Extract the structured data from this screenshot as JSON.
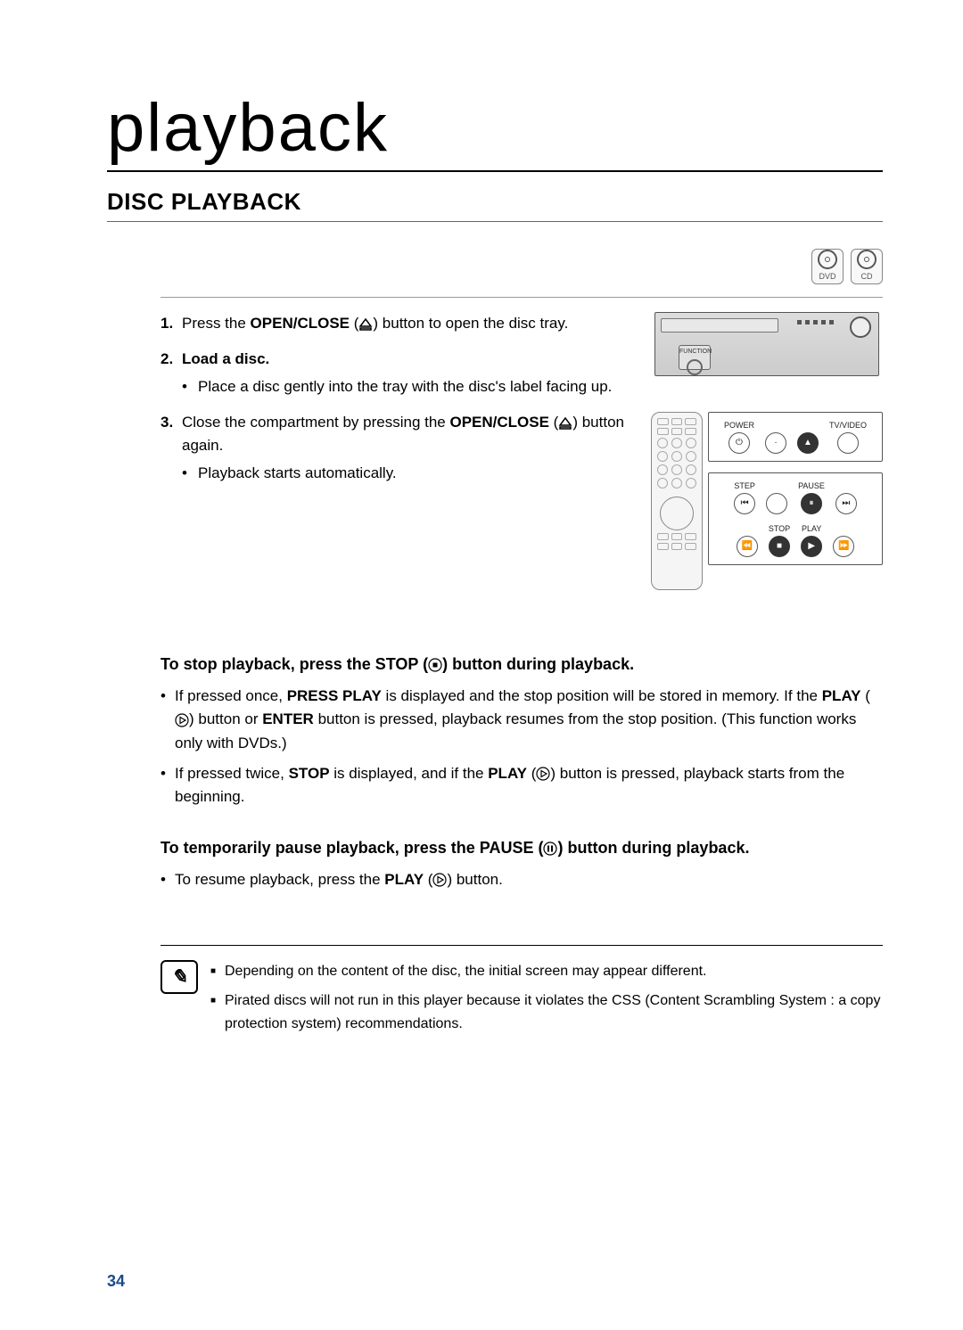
{
  "title": "playback",
  "section_heading": "DISC PLAYBACK",
  "badges": {
    "dvd": "DVD",
    "cd": "CD"
  },
  "steps": [
    {
      "num": "1.",
      "text_pre": "Press the ",
      "bold": "OPEN/CLOSE",
      "text_mid": " (",
      "text_post": ") button to open the disc tray."
    },
    {
      "num": "2.",
      "bold": "Load a disc.",
      "sub": "Place a disc gently into the tray with the disc's label facing up."
    },
    {
      "num": "3.",
      "text_pre": "Close the compartment by pressing the ",
      "bold": "OPEN/CLOSE",
      "text_mid": " (",
      "text_post": ") button again.",
      "sub": "Playback starts automatically."
    }
  ],
  "player": {
    "function_label": "FUNCTION"
  },
  "remote_callout": {
    "row1": {
      "power": "POWER",
      "tv": "TV/VIDEO"
    },
    "row2": {
      "step": "STEP",
      "pause": "PAUSE",
      "stop": "STOP",
      "play": "PLAY"
    }
  },
  "stop_section": {
    "heading_pre": "To stop playback, press the STOP (",
    "heading_post": ") button during playback.",
    "bullets": [
      {
        "parts": [
          {
            "t": "If pressed once, "
          },
          {
            "b": "PRESS PLAY"
          },
          {
            "t": " is displayed and the stop position will be stored in memory. If the "
          },
          {
            "b": "PLAY"
          },
          {
            "t": " ("
          },
          {
            "icon": "play"
          },
          {
            "t": ") button or "
          },
          {
            "b": "ENTER"
          },
          {
            "t": " button is pressed, playback resumes from the stop position. (This function works only with DVDs.)"
          }
        ]
      },
      {
        "parts": [
          {
            "t": "If pressed twice, "
          },
          {
            "b": "STOP"
          },
          {
            "t": " is displayed, and if the "
          },
          {
            "b": "PLAY"
          },
          {
            "t": " ("
          },
          {
            "icon": "play"
          },
          {
            "t": ") button is pressed, playback starts from the beginning."
          }
        ]
      }
    ]
  },
  "pause_section": {
    "heading_pre": "To temporarily pause playback, press the PAUSE (",
    "heading_post": ") button during playback.",
    "bullet_pre": "To resume playback, press the ",
    "bullet_bold": "PLAY",
    "bullet_mid": " (",
    "bullet_post": ") button."
  },
  "notes": [
    "Depending on the content of the disc, the initial screen may appear different.",
    "Pirated discs will not run in this player because it violates the CSS (Content Scrambling System : a copy protection system) recommendations."
  ],
  "page_number": "34"
}
